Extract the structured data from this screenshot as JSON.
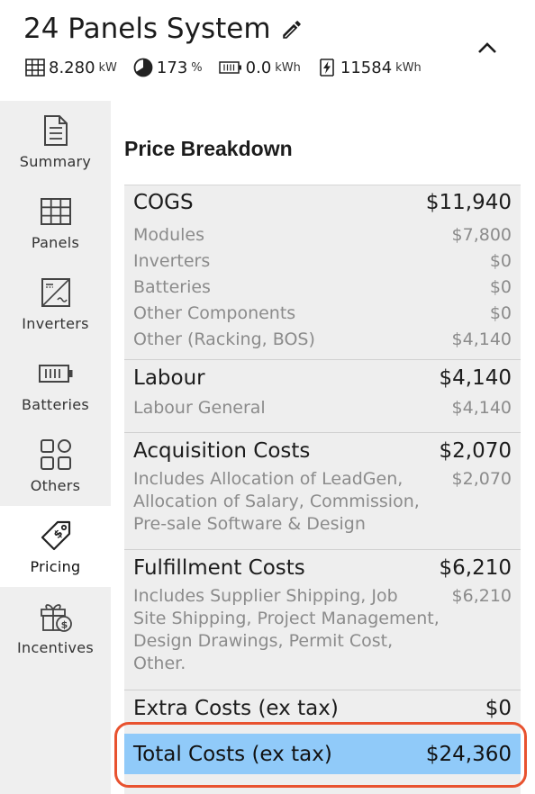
{
  "header": {
    "title": "24 Panels System",
    "stats": [
      {
        "icon": "panel-grid-icon",
        "value": "8.280",
        "unit": "kW"
      },
      {
        "icon": "offset-pie-icon",
        "value": "173",
        "unit": "%"
      },
      {
        "icon": "battery-icon",
        "value": "0.0",
        "unit": "kWh"
      },
      {
        "icon": "energy-bolt-icon",
        "value": "11584",
        "unit": "kWh"
      }
    ]
  },
  "sidebar": {
    "items": [
      {
        "label": "Summary",
        "icon": "document-icon",
        "active": false
      },
      {
        "label": "Panels",
        "icon": "panel-grid-icon",
        "active": false
      },
      {
        "label": "Inverters",
        "icon": "inverter-icon",
        "active": false
      },
      {
        "label": "Batteries",
        "icon": "battery-icon",
        "active": false
      },
      {
        "label": "Others",
        "icon": "grid-shapes-icon",
        "active": false
      },
      {
        "label": "Pricing",
        "icon": "price-tag-icon",
        "active": true
      },
      {
        "label": "Incentives",
        "icon": "gift-dollar-icon",
        "active": false
      }
    ]
  },
  "pricing": {
    "title": "Price Breakdown",
    "groups": [
      {
        "name": "COGS",
        "amount": "$11,940",
        "lines": [
          {
            "label": "Modules",
            "amount": "$7,800"
          },
          {
            "label": "Inverters",
            "amount": "$0"
          },
          {
            "label": "Batteries",
            "amount": "$0"
          },
          {
            "label": "Other Components",
            "amount": "$0"
          },
          {
            "label": "Other (Racking, BOS)",
            "amount": "$4,140"
          }
        ]
      },
      {
        "name": "Labour",
        "amount": "$4,140",
        "lines": [
          {
            "label": "Labour General",
            "amount": "$4,140"
          }
        ]
      },
      {
        "name": "Acquisition Costs",
        "amount": "$2,070",
        "lines": [
          {
            "label_lines": [
              "Includes Allocation of LeadGen,",
              "Allocation of Salary, Commission,",
              "Pre-sale Software & Design"
            ],
            "amount": "$2,070"
          }
        ]
      },
      {
        "name": "Fulfillment Costs",
        "amount": "$6,210",
        "lines": [
          {
            "label_lines": [
              "Includes Supplier Shipping, Job",
              "Site Shipping, Project Management,",
              "Design Drawings, Permit Cost,",
              "Other."
            ],
            "amount": "$6,210"
          }
        ]
      },
      {
        "name": "Extra Costs (ex tax)",
        "amount": "$0",
        "lines": []
      }
    ],
    "total": {
      "label": "Total Costs (ex tax)",
      "amount": "$24,360"
    }
  },
  "colors": {
    "total_highlight": "#90caf9",
    "annotation_ring": "#e8522f",
    "sidebar_bg": "#efefef",
    "panel_bg": "#eeeeee"
  }
}
